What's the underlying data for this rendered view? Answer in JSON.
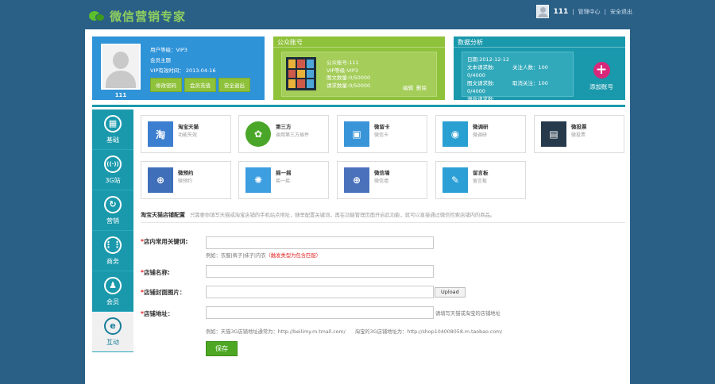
{
  "header": {
    "logo_text": "微信营销专家",
    "username": "111",
    "sep1": "|",
    "admin_link": "管理中心",
    "sep2": "|",
    "logout_link": "安全退出"
  },
  "user_card": {
    "name": "111",
    "level": "用户等级：VIP3",
    "role": "会员主题",
    "expire": "VIP有效时间：  2013-04-16",
    "buttons": [
      "修改密码",
      "会员充值",
      "安全退出"
    ]
  },
  "account_card": {
    "title": "公众账号",
    "name": "公众账号:111",
    "level": "VIP等级:VIP3",
    "articles": "图文数量:0/50000",
    "requests": "请求数量:0/50000",
    "edit": "编辑",
    "delete": "删除"
  },
  "stats_card": {
    "title": "数据分析",
    "date": "日期:2012-12-12",
    "rows": [
      {
        "k": "文本请求数: 0/4000",
        "v": "关注人数：100"
      },
      {
        "k": "图文请求数: 0/4000",
        "v": "取消关注：100"
      },
      {
        "k": "语音请求数: 0/4000",
        "v": ""
      }
    ],
    "add_label": "添加账号",
    "add_symbol": "+"
  },
  "sidebar": {
    "items": [
      {
        "label": "基础",
        "glyph": "▦"
      },
      {
        "label": "3G站",
        "glyph": "((·))"
      },
      {
        "label": "营销",
        "glyph": "↻"
      },
      {
        "label": "商务",
        "glyph": "⋮⋮"
      },
      {
        "label": "会员",
        "glyph": "♟"
      },
      {
        "label": "互动",
        "glyph": "e"
      }
    ]
  },
  "tiles": [
    {
      "title": "淘宝天猫",
      "sub": "功能失效",
      "glyph": "淘",
      "color": "#3c7ed0"
    },
    {
      "title": "第三方",
      "sub": "调用第三方插件",
      "glyph": "✿",
      "color": "#4aa628"
    },
    {
      "title": "微留卡",
      "sub": "微信卡",
      "glyph": "▣",
      "color": "#3a95d8"
    },
    {
      "title": "微调研",
      "sub": "微调研",
      "glyph": "◉",
      "color": "#2a9fd2"
    },
    {
      "title": "微投票",
      "sub": "微投票",
      "glyph": "▤",
      "color": "#273a4c"
    },
    {
      "title": "微预约",
      "sub": "微预约",
      "glyph": "⊕",
      "color": "#3f6fb8"
    },
    {
      "title": "摇一摇",
      "sub": "摇一摇",
      "glyph": "✺",
      "color": "#3d9ee0"
    },
    {
      "title": "微信墙",
      "sub": "微信墙",
      "glyph": "⊕",
      "color": "#4a72bb"
    },
    {
      "title": "留言板",
      "sub": "留言板",
      "glyph": "✎",
      "color": "#2ca0d6"
    }
  ],
  "config": {
    "title": "淘宝天猫店铺配置",
    "desc": "只需要你填写天猫或淘宝店铺的手机站点地址，随举配置关键词，再在功能管理页面开启此功能，就可以直接通过微信检索店铺内的商品。",
    "required_mark": "*",
    "keyword_label": "店内常用关键词:",
    "keyword_hint": "例如：衣服|裤子|袜子|内衣",
    "keyword_warn": "（触发类型为包含匹配）",
    "shopname_label": "店铺名称:",
    "cover_label": "店铺封面图片：",
    "upload_label": "Upload",
    "address_label": "店铺地址：",
    "address_hint": "请填写天猫或淘宝的店铺地址",
    "example": "例如：天猫3G店铺地址通常为：http://beilimy.m.tmall.com/      淘宝的3G店铺地址为：http://shop104008058.m.taobao.com/",
    "save_label": "保存"
  }
}
